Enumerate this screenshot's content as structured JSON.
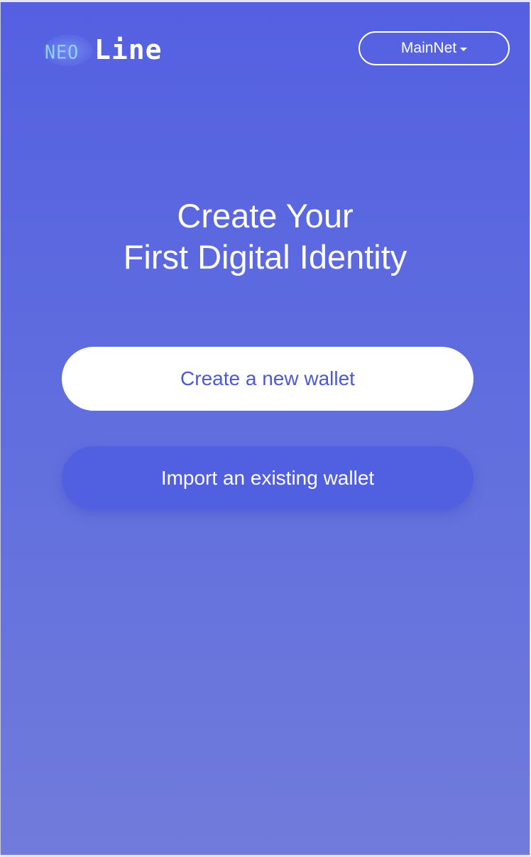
{
  "header": {
    "logo": {
      "part1": "NEO",
      "part2": "Line"
    },
    "network": {
      "label": "MainNet",
      "icon": "caret-down-icon"
    }
  },
  "main": {
    "title_line1": "Create Your",
    "title_line2": "First Digital Identity",
    "create_button_label": "Create a new wallet",
    "import_button_label": "Import an existing wallet"
  },
  "colors": {
    "background_top": "#5460e1",
    "background_bottom": "#717bdb",
    "primary_button_bg": "#ffffff",
    "primary_button_text": "#4c58d6",
    "secondary_button_bg": "#5160e0"
  }
}
